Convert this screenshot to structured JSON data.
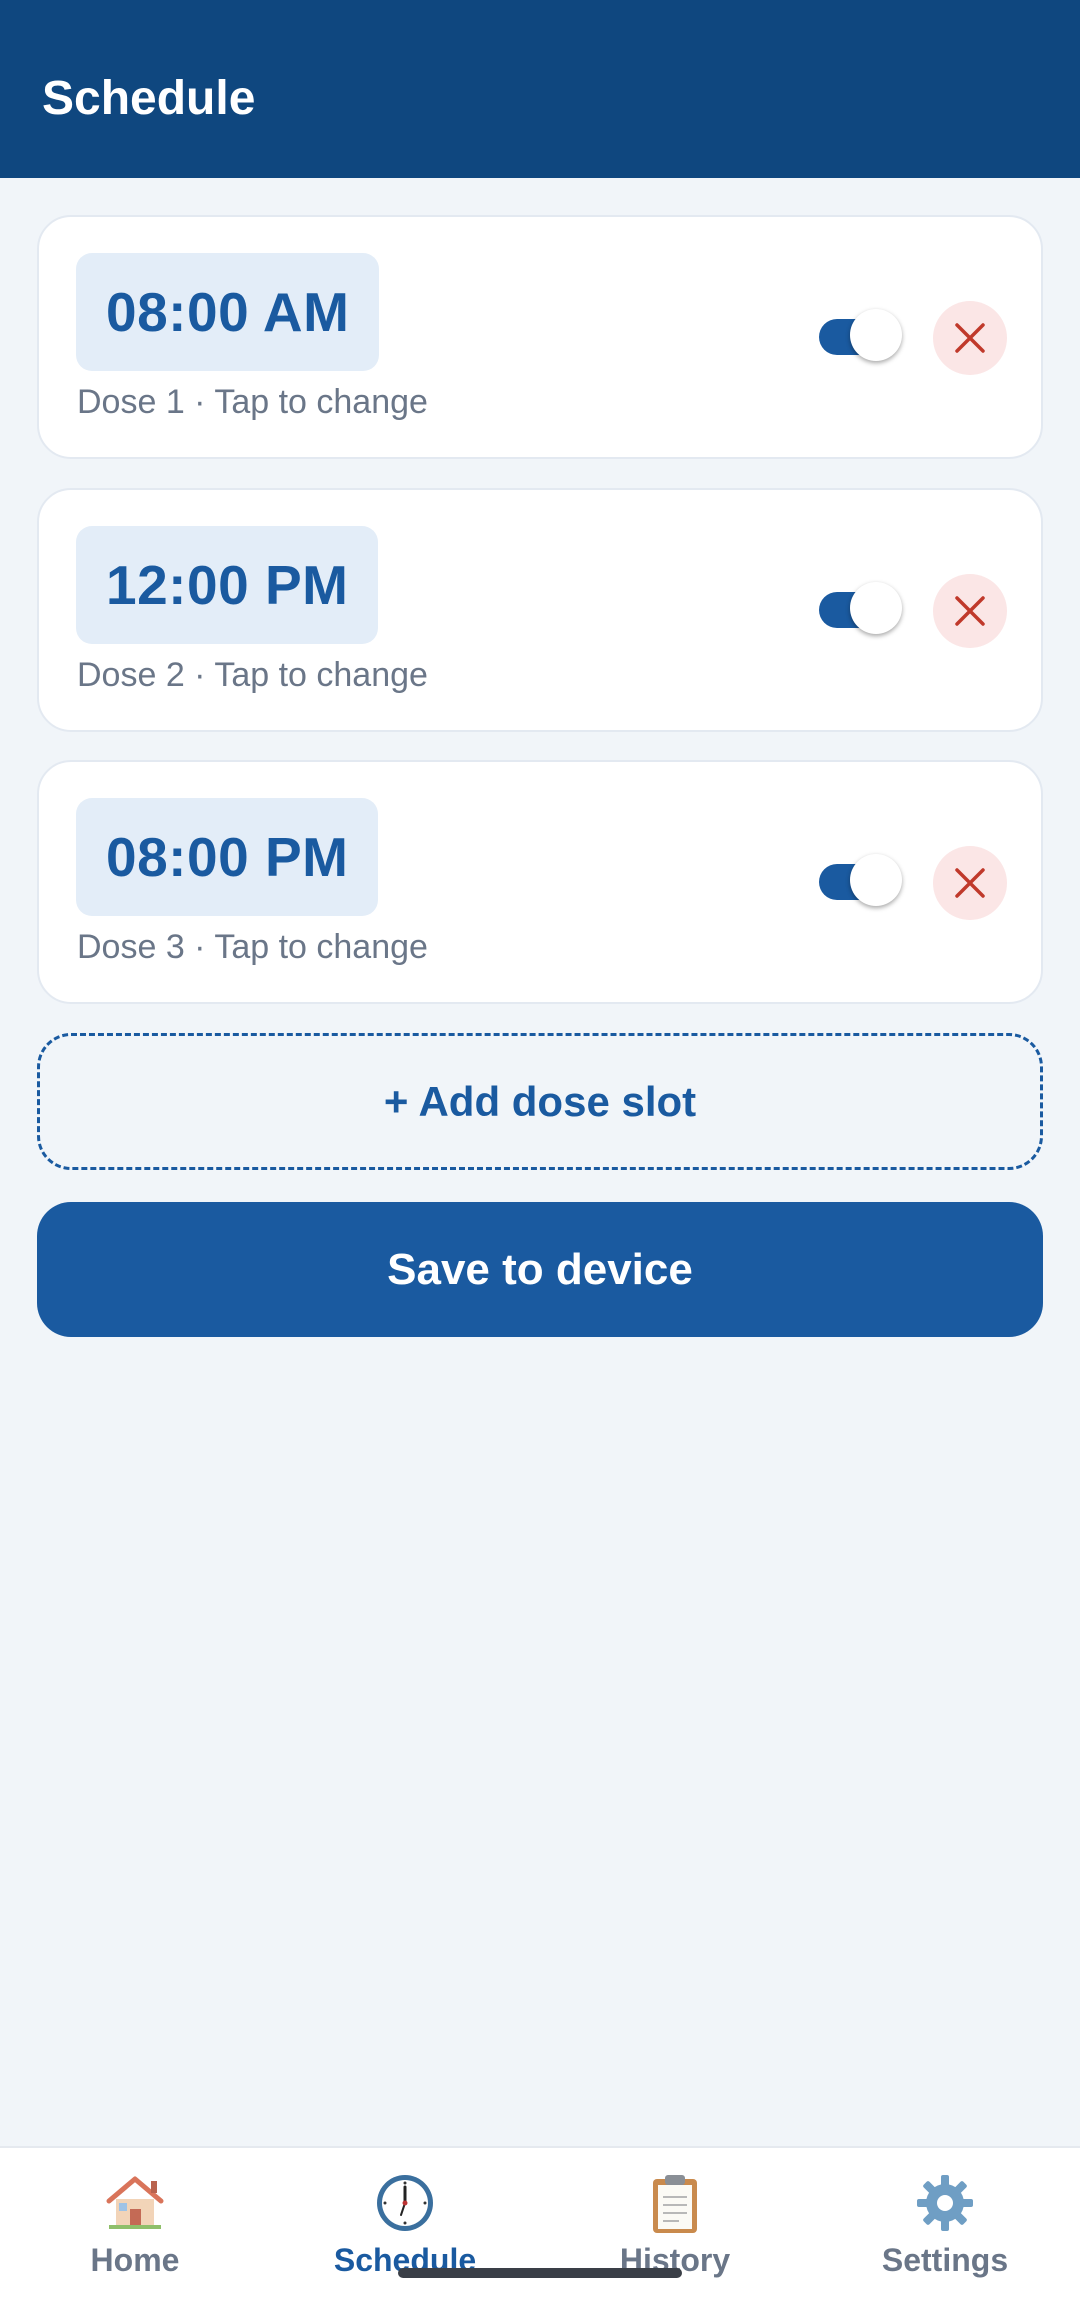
{
  "header": {
    "title": "Schedule"
  },
  "doses": [
    {
      "time": "08:00 AM",
      "subtitle": "Dose 1 · Tap to change",
      "enabled": true
    },
    {
      "time": "12:00 PM",
      "subtitle": "Dose 2 · Tap to change",
      "enabled": true
    },
    {
      "time": "08:00 PM",
      "subtitle": "Dose 3 · Tap to change",
      "enabled": true
    }
  ],
  "actions": {
    "add_label": "+ Add dose slot",
    "save_label": "Save to device"
  },
  "nav": {
    "items": [
      {
        "label": "Home",
        "icon": "house-icon",
        "active": false
      },
      {
        "label": "Schedule",
        "icon": "clock-icon",
        "active": true
      },
      {
        "label": "History",
        "icon": "clipboard-icon",
        "active": false
      },
      {
        "label": "Settings",
        "icon": "gear-icon",
        "active": false
      }
    ]
  },
  "colors": {
    "header": "#0f477f",
    "accent": "#1a5aa0",
    "delete": "#c0392b",
    "background": "#f1f5f9"
  }
}
